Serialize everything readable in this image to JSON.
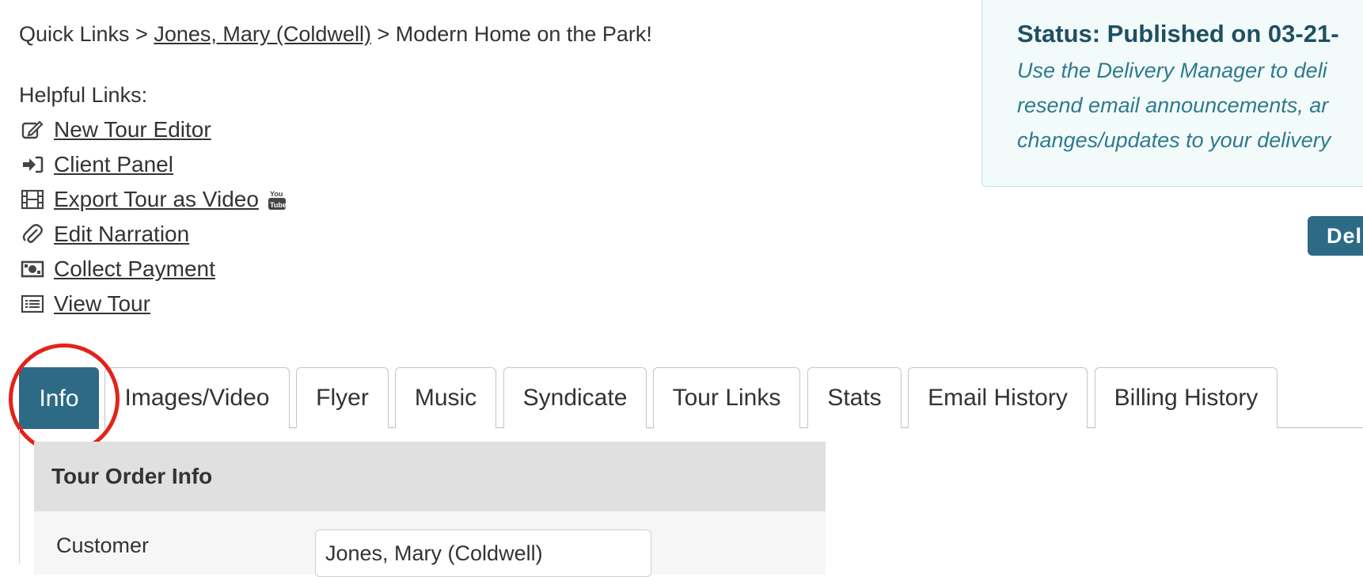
{
  "breadcrumb": {
    "root": "Quick Links",
    "separator": ">",
    "customer_link": "Jones, Mary (Coldwell)",
    "current": "Modern Home on the Park!"
  },
  "helpful_links": {
    "title": "Helpful Links:",
    "items": [
      {
        "icon": "edit-icon",
        "label": "New Tour Editor"
      },
      {
        "icon": "sign-in-icon",
        "label": "Client Panel"
      },
      {
        "icon": "film-icon",
        "label": "Export Tour as Video",
        "extra_icon": "youtube-icon"
      },
      {
        "icon": "paperclip-icon",
        "label": "Edit Narration"
      },
      {
        "icon": "money-icon",
        "label": "Collect Payment"
      },
      {
        "icon": "list-icon",
        "label": "View Tour"
      }
    ]
  },
  "status": {
    "title": "Status: Published on 03-21-",
    "line1": "Use the Delivery Manager to deli",
    "line2": "resend email announcements, ar",
    "line3": "changes/updates to your delivery"
  },
  "deliver_button": {
    "label": "Del"
  },
  "tabs": [
    {
      "label": "Info",
      "active": true
    },
    {
      "label": "Images/Video"
    },
    {
      "label": "Flyer"
    },
    {
      "label": "Music"
    },
    {
      "label": "Syndicate"
    },
    {
      "label": "Tour Links"
    },
    {
      "label": "Stats"
    },
    {
      "label": "Email History"
    },
    {
      "label": "Billing History"
    }
  ],
  "tour_order": {
    "heading": "Tour Order Info",
    "customer_label": "Customer",
    "customer_value": "Jones, Mary (Coldwell)"
  },
  "colors": {
    "accent": "#2d6a86",
    "status_bg": "#f2fafa",
    "status_text": "#2f7a8e",
    "highlight_circle": "#e3231b"
  }
}
